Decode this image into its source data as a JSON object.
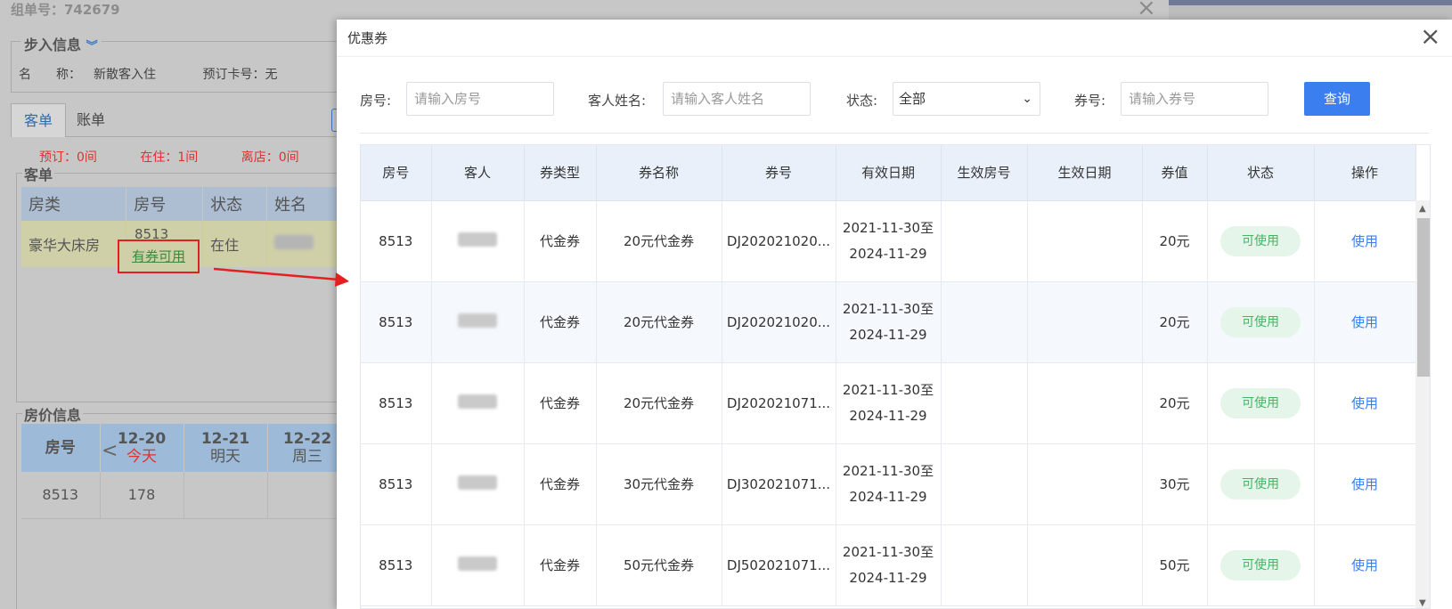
{
  "background": {
    "order_title": "组单号：742679",
    "checkin_info": {
      "legend": "步入信息",
      "name_label": "名　　称：",
      "name_value": "新散客入住",
      "card_label": "预订卡号：",
      "card_value": "无"
    },
    "tabs": [
      "客单",
      "账单"
    ],
    "counts": [
      "预订：0间",
      "在住：1间",
      "离店：0间"
    ],
    "guest_section": {
      "legend": "客单",
      "headers": [
        "房类",
        "房号",
        "状态",
        "姓名"
      ],
      "row": {
        "room_type": "豪华大床房",
        "room_no": "8513",
        "coupon_tag": "有券可用",
        "status": "在住"
      }
    },
    "price_section": {
      "legend": "房价信息",
      "room_header": "房号",
      "prev": "<",
      "days": [
        {
          "date": "12-20",
          "label": "今天"
        },
        {
          "date": "12-21",
          "label": "明天"
        },
        {
          "date": "12-22",
          "label": "周三"
        }
      ],
      "row": {
        "room": "8513",
        "price": "178"
      }
    }
  },
  "modal": {
    "title": "优惠券",
    "close": "×",
    "filters": {
      "room_label": "房号:",
      "room_placeholder": "请输入房号",
      "guest_label": "客人姓名:",
      "guest_placeholder": "请输入客人姓名",
      "status_label": "状态:",
      "status_value": "全部",
      "coupon_label": "券号:",
      "coupon_placeholder": "请输入券号",
      "query_button": "查询"
    },
    "columns": [
      "房号",
      "客人",
      "券类型",
      "券名称",
      "券号",
      "有效日期",
      "生效房号",
      "生效日期",
      "券值",
      "状态",
      "操作"
    ],
    "rows": [
      {
        "room": "8513",
        "type": "代金券",
        "name": "20元代金券",
        "code": "DJ202021020...",
        "valid_from": "2021-11-30至",
        "valid_to": "2024-11-29",
        "eff_room": "",
        "eff_date": "",
        "value": "20元",
        "status": "可使用",
        "action": "使用"
      },
      {
        "room": "8513",
        "type": "代金券",
        "name": "20元代金券",
        "code": "DJ202021020...",
        "valid_from": "2021-11-30至",
        "valid_to": "2024-11-29",
        "eff_room": "",
        "eff_date": "",
        "value": "20元",
        "status": "可使用",
        "action": "使用"
      },
      {
        "room": "8513",
        "type": "代金券",
        "name": "20元代金券",
        "code": "DJ202021071...",
        "valid_from": "2021-11-30至",
        "valid_to": "2024-11-29",
        "eff_room": "",
        "eff_date": "",
        "value": "20元",
        "status": "可使用",
        "action": "使用"
      },
      {
        "room": "8513",
        "type": "代金券",
        "name": "30元代金券",
        "code": "DJ302021071...",
        "valid_from": "2021-11-30至",
        "valid_to": "2024-11-29",
        "eff_room": "",
        "eff_date": "",
        "value": "30元",
        "status": "可使用",
        "action": "使用"
      },
      {
        "room": "8513",
        "type": "代金券",
        "name": "50元代金券",
        "code": "DJ502021071...",
        "valid_from": "2021-11-30至",
        "valid_to": "2024-11-29",
        "eff_room": "",
        "eff_date": "",
        "value": "50元",
        "status": "可使用",
        "action": "使用"
      }
    ]
  },
  "colors": {
    "primary": "#3b7ef0",
    "badge_bg": "#e5f5ea",
    "badge_text": "#46b365",
    "annotation": "#e32020"
  }
}
